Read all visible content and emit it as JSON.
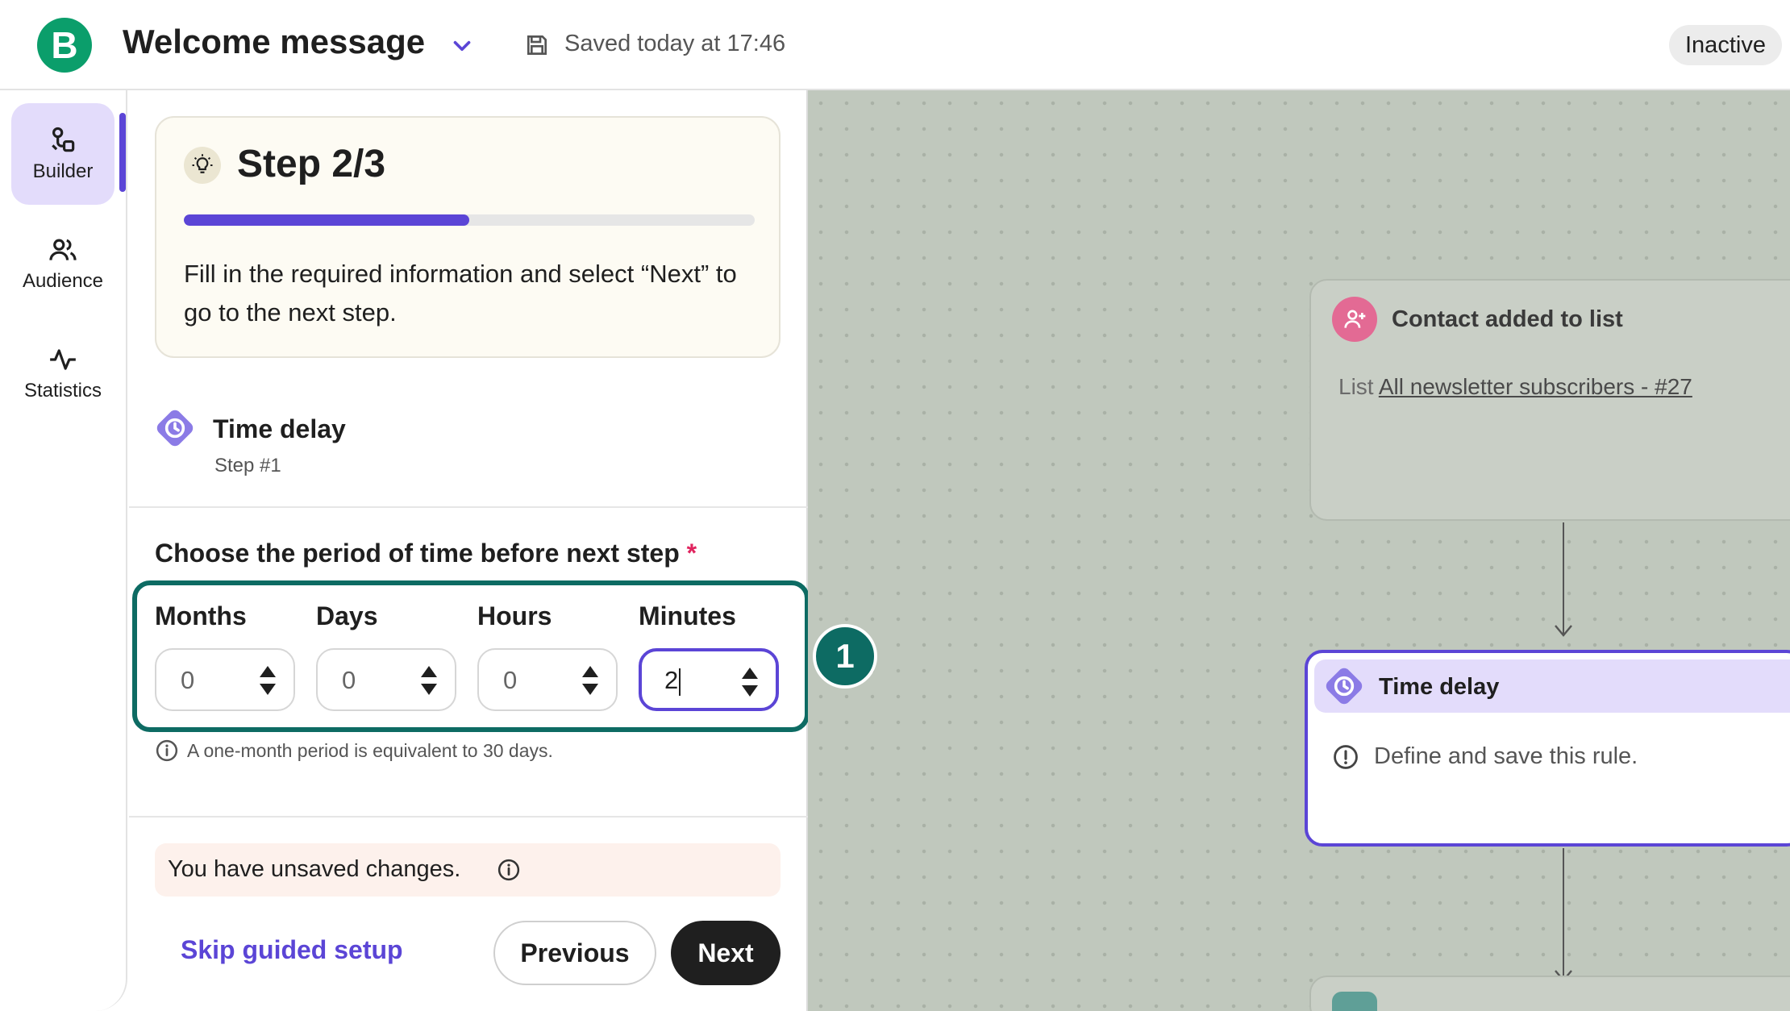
{
  "header": {
    "logo_letter": "B",
    "title": "Welcome message",
    "saved_text": "Saved today at 17:46",
    "status": "Inactive"
  },
  "nav": {
    "items": [
      {
        "label": "Builder",
        "icon": "builder-icon",
        "active": true
      },
      {
        "label": "Audience",
        "icon": "audience-icon",
        "active": false
      },
      {
        "label": "Statistics",
        "icon": "statistics-icon",
        "active": false
      }
    ]
  },
  "panel": {
    "step_title": "Step 2/3",
    "progress_fraction": 0.5,
    "step_description": "Fill in the required information and select “Next” to go to the next step.",
    "block_title": "Time delay",
    "block_step": "Step #1",
    "period_label": "Choose the period of time before next step",
    "required_mark": "*",
    "fields": [
      {
        "label": "Months",
        "value": "0"
      },
      {
        "label": "Days",
        "value": "0"
      },
      {
        "label": "Hours",
        "value": "0"
      },
      {
        "label": "Minutes",
        "value": "2"
      }
    ],
    "hint": "A one-month period is equivalent to 30 days.",
    "unsaved": "You have unsaved changes.",
    "skip_label": "Skip guided setup",
    "previous_label": "Previous",
    "next_label": "Next"
  },
  "callout": "1",
  "canvas": {
    "trigger_node": {
      "title": "Contact added to list",
      "detail_prefix": "List",
      "detail_link": "All newsletter subscribers - #27"
    },
    "delay_node": {
      "title": "Time delay",
      "warning": "Define and save this rule."
    }
  },
  "colors": {
    "brand_green": "#0b9e6b",
    "accent_purple": "#5b45d6",
    "callout_teal": "#0d6b63",
    "canvas_bg": "#c0c8bd"
  }
}
